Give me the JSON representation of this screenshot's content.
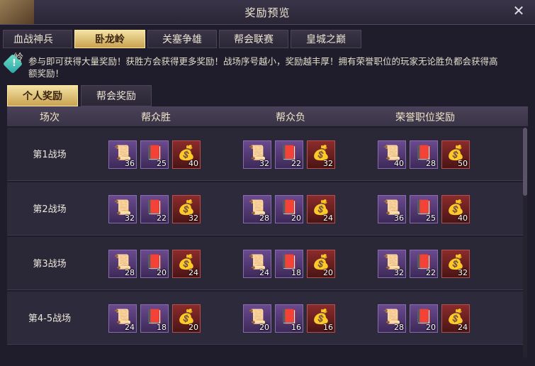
{
  "window": {
    "title": "奖励预览",
    "close_icon": "close-icon"
  },
  "top_tabs": [
    "血战神兵岭",
    "卧龙岭",
    "关塞争雄",
    "帮会联赛",
    "皇城之巅"
  ],
  "active_top_tab": 1,
  "notice": "参与即可获得大量奖励！获胜方会获得更多奖励！战场序号越小，奖励越丰厚！拥有荣誉职位的玩家无论胜负都会获得高额奖励！",
  "sub_tabs": [
    "个人奖励",
    "帮会奖励"
  ],
  "active_sub_tab": 0,
  "table": {
    "headers": [
      "场次",
      "帮众胜",
      "帮众负",
      "荣誉职位奖励"
    ],
    "rows": [
      {
        "label": "第1战场",
        "win": [
          36,
          25,
          40
        ],
        "lose": [
          32,
          22,
          32
        ],
        "honor": [
          40,
          28,
          50
        ]
      },
      {
        "label": "第2战场",
        "win": [
          32,
          22,
          32
        ],
        "lose": [
          28,
          20,
          24
        ],
        "honor": [
          36,
          25,
          40
        ]
      },
      {
        "label": "第3战场",
        "win": [
          28,
          20,
          24
        ],
        "lose": [
          24,
          18,
          20
        ],
        "honor": [
          32,
          22,
          32
        ]
      },
      {
        "label": "第4-5战场",
        "win": [
          24,
          18,
          20
        ],
        "lose": [
          20,
          16,
          16
        ],
        "honor": [
          28,
          20,
          24
        ]
      }
    ]
  },
  "item_icons": [
    "scroll-icon",
    "book-icon",
    "bag-icon"
  ],
  "colors": {
    "gold_tab": "#c9a250",
    "purple_frame": "#6a4a8e",
    "red_frame": "#8b2b2b"
  }
}
